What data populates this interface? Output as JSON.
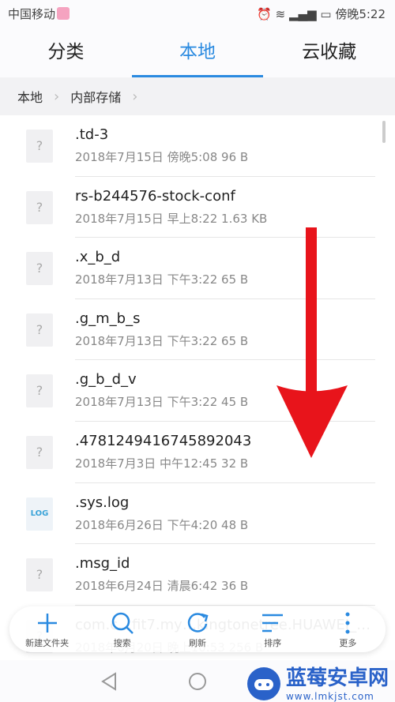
{
  "status": {
    "carrier": "中国移动",
    "time": "傍晚5:22",
    "icons": [
      "alarm-icon",
      "wifi-icon",
      "signal-4g-icon",
      "battery-icon"
    ]
  },
  "tabs": [
    {
      "label": "分类"
    },
    {
      "label": "本地",
      "active": true
    },
    {
      "label": "云收藏"
    }
  ],
  "breadcrumb": [
    "本地",
    "内部存储"
  ],
  "files": [
    {
      "name": ".td-3",
      "meta": "2018年7月15日 傍晚5:08 96 B",
      "type": "unknown"
    },
    {
      "name": "rs-b244576-stock-conf",
      "meta": "2018年7月15日 早上8:22 1.63 KB",
      "type": "unknown"
    },
    {
      "name": ".x_b_d",
      "meta": "2018年7月13日 下午3:22 65 B",
      "type": "unknown"
    },
    {
      "name": ".g_m_b_s",
      "meta": "2018年7月13日 下午3:22 65 B",
      "type": "unknown"
    },
    {
      "name": ".g_b_d_v",
      "meta": "2018年7月13日 下午3:22 45 B",
      "type": "unknown"
    },
    {
      "name": ".4781249416745892043",
      "meta": "2018年7月3日 中午12:45 32 B",
      "type": "unknown"
    },
    {
      "name": ".sys.log",
      "meta": "2018年6月26日 下午4:20 48 B",
      "type": "log",
      "icon_label": "LOG"
    },
    {
      "name": ".msg_id",
      "meta": "2018年6月24日 清晨6:42 36 B",
      "type": "unknown"
    },
    {
      "name": "com.c…fit7.my…kingtonetree.HUAWEI_…",
      "meta": "2018年6月20日 晚上10:53 256 B",
      "type": "unknown"
    }
  ],
  "toolbar": [
    {
      "label": "新建文件夹",
      "icon": "plus-icon"
    },
    {
      "label": "搜索",
      "icon": "search-icon"
    },
    {
      "label": "刷新",
      "icon": "refresh-icon"
    },
    {
      "label": "排序",
      "icon": "sort-icon"
    },
    {
      "label": "更多",
      "icon": "more-icon"
    }
  ],
  "watermark": {
    "title": "蓝莓安卓网",
    "url": "www.lmkjst.com"
  },
  "colors": {
    "accent": "#2a8ae0",
    "arrow": "#e8141b"
  }
}
